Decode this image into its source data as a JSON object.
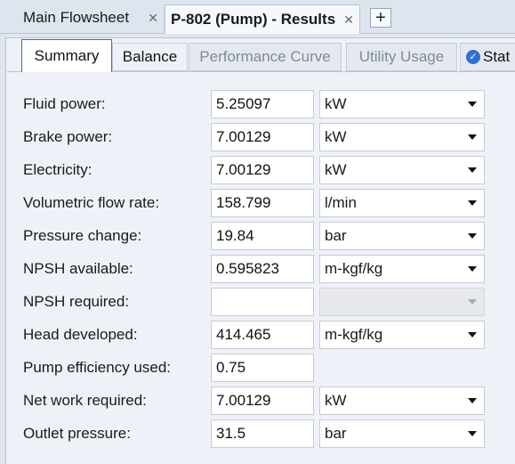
{
  "doc_tabs": [
    {
      "label": "Main Flowsheet",
      "active": false
    },
    {
      "label": "P-802 (Pump) - Results",
      "active": true
    }
  ],
  "sub_tabs": {
    "summary": "Summary",
    "balance": "Balance",
    "performance_curve": "Performance Curve",
    "utility_usage": "Utility Usage",
    "status": "Stat"
  },
  "rows": [
    {
      "label": "Fluid power:",
      "value": "5.25097",
      "unit": "kW"
    },
    {
      "label": "Brake power:",
      "value": "7.00129",
      "unit": "kW"
    },
    {
      "label": "Electricity:",
      "value": "7.00129",
      "unit": "kW"
    },
    {
      "label": "Volumetric flow rate:",
      "value": "158.799",
      "unit": "l/min"
    },
    {
      "label": "Pressure change:",
      "value": "19.84",
      "unit": "bar"
    },
    {
      "label": "NPSH available:",
      "value": "0.595823",
      "unit": "m-kgf/kg"
    },
    {
      "label": "NPSH required:",
      "value": "",
      "unit": ""
    },
    {
      "label": "Head developed:",
      "value": "414.465",
      "unit": "m-kgf/kg"
    },
    {
      "label": "Pump efficiency used:",
      "value": "0.75"
    },
    {
      "label": "Net work required:",
      "value": "7.00129",
      "unit": "kW"
    },
    {
      "label": "Outlet pressure:",
      "value": "31.5",
      "unit": "bar"
    }
  ],
  "colors": {
    "active_tab_border": "#3b6fb8",
    "status_icon": "#2f6fd6"
  }
}
